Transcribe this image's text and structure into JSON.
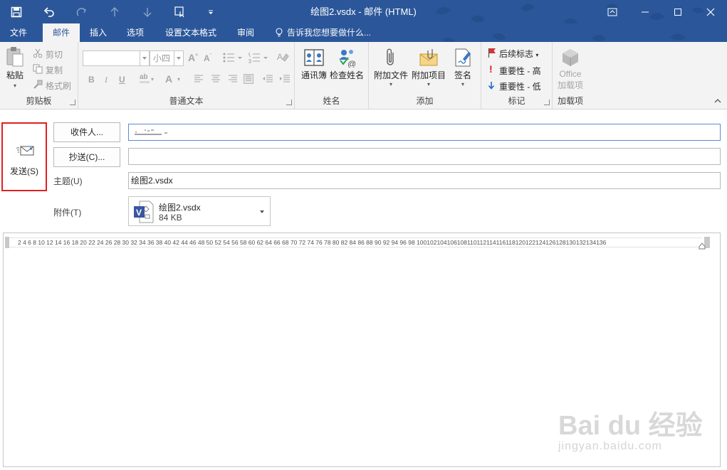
{
  "window": {
    "title": "绘图2.vsdx - 邮件 (HTML)"
  },
  "tabs": [
    {
      "label": "文件",
      "active": false
    },
    {
      "label": "邮件",
      "active": true
    },
    {
      "label": "插入",
      "active": false
    },
    {
      "label": "选项",
      "active": false
    },
    {
      "label": "设置文本格式",
      "active": false
    },
    {
      "label": "审阅",
      "active": false
    }
  ],
  "tellme": "告诉我您想要做什么...",
  "ribbon": {
    "clipboard": {
      "label": "剪贴板",
      "paste": "粘贴",
      "cut": "剪切",
      "copy": "复制",
      "format_painter": "格式刷"
    },
    "basic_text": {
      "label": "普通文本",
      "font_size": "小四"
    },
    "names": {
      "label": "姓名",
      "address_book": "通讯簿",
      "check_names": "检查姓名"
    },
    "include": {
      "label": "添加",
      "attach_file": "附加文件",
      "attach_item": "附加项目",
      "signature": "签名"
    },
    "tags": {
      "label": "标记",
      "follow_up": "后续标志",
      "high": "重要性 - 高",
      "low": "重要性 - 低"
    },
    "addins": {
      "label": "加载项",
      "office1": "Office",
      "office2": "加载项"
    }
  },
  "compose": {
    "send_label": "发送(S)",
    "to_button": "收件人...",
    "cc_button": "抄送(C)...",
    "to_value": "",
    "cc_value": "",
    "subject_label": "主题(U)",
    "subject_value": "绘图2.vsdx",
    "attach_label": "附件(T)",
    "attachment": {
      "name": "绘图2.vsdx",
      "size": "84 KB"
    }
  },
  "ruler": {
    "numbers": "2 4 6 8 10 12 14 16 18 20 22 24 26 28 30 32 34 36 38 40 42 44 46 48 50 52 54 56 58 60 62 64 66 68 70 72 74 76 78 80 82 84 86 88 90 92 94 96 98 100102104106108110112114116118120122124126128130132134136"
  },
  "watermark": {
    "line1": "Bai du 经验",
    "line2": "jingyan.baidu.com"
  },
  "colors": {
    "brand": "#2b579a",
    "highlight": "#e02020",
    "flag": "#d13438",
    "importance_high": "#e81123",
    "importance_low": "#1e6bc9"
  }
}
